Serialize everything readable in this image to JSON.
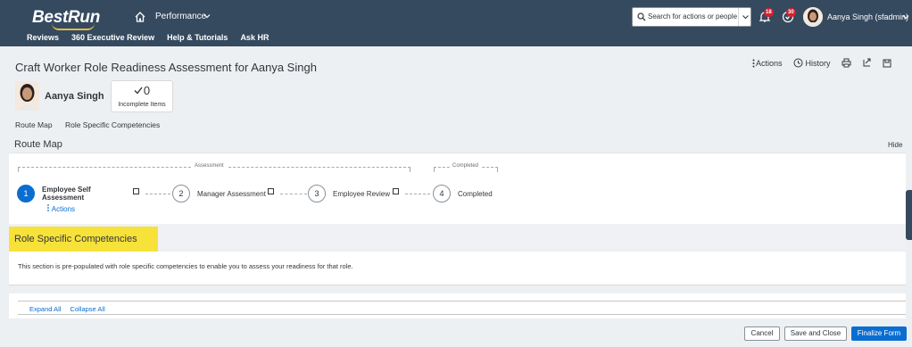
{
  "shell": {
    "logo": "BestRun",
    "module": "Performance",
    "nav": [
      "Reviews",
      "360 Executive Review",
      "Help & Tutorials",
      "Ask HR"
    ],
    "search_placeholder": "Search for actions or people",
    "notifications_count": "18",
    "todo_count": "30",
    "user_name": "Aanya Singh (sfadmin)"
  },
  "form": {
    "title": "Craft Worker Role Readiness Assessment for Aanya Singh",
    "actions_label": "Actions",
    "history_label": "History",
    "employee_name": "Aanya Singh",
    "incomplete_count": "0",
    "incomplete_label": "Incomplete Items",
    "anchors": [
      "Route Map",
      "Role Specific Competencies"
    ]
  },
  "route_map": {
    "title": "Route Map",
    "hide_label": "Hide",
    "phases": [
      "Assessment",
      "Completed"
    ],
    "steps": [
      {
        "number": "1",
        "label": "Employee Self Assessment"
      },
      {
        "number": "2",
        "label": "Manager Assessment"
      },
      {
        "number": "3",
        "label": "Employee Review"
      },
      {
        "number": "4",
        "label": "Completed"
      }
    ],
    "step_actions": "Actions"
  },
  "competencies": {
    "title": "Role Specific Competencies",
    "description": "This section is pre-populated with role specific competencies to enable you to assess your readiness for that role.",
    "expand_all": "Expand All",
    "collapse_all": "Collapse All"
  },
  "footer": {
    "cancel": "Cancel",
    "save_close": "Save and Close",
    "finalize": "Finalize Form"
  },
  "colors": {
    "shell": "#354a5f",
    "accent": "#0a6ed1",
    "highlight": "#f7e23a",
    "badge": "#d32030"
  }
}
